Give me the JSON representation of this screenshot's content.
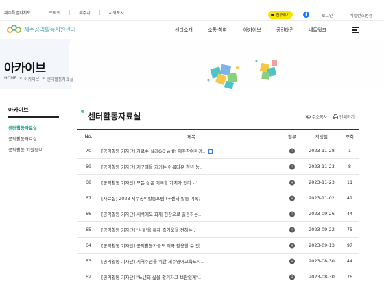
{
  "topbar": {
    "links": [
      "제주특별자치도",
      "도의회",
      "제주시",
      "서귀포시"
    ],
    "kakao_label": "친구추가",
    "facebook_glyph": "f",
    "login": "로그인",
    "password": "비밀번호변경"
  },
  "header": {
    "logo_text": "제주공익활동지원센터",
    "nav": [
      "센터소개",
      "소통·참여",
      "아카이브",
      "공간대관",
      "네트워크"
    ]
  },
  "hero": {
    "title": "아카이브",
    "breadcrumb": [
      "HOME",
      ">",
      "아카이브",
      ">",
      "센터활동자료실"
    ]
  },
  "sidebar": {
    "title": "아카이브",
    "items": [
      {
        "label": "센터활동자료실",
        "active": true
      },
      {
        "label": "공익활동자료실",
        "active": false
      },
      {
        "label": "공익활동 지원정보",
        "active": false
      }
    ]
  },
  "content": {
    "title": "센터활동자료실",
    "copy_address": "주소복사",
    "print": "인쇄하기",
    "columns": {
      "no": "No.",
      "title": "제목",
      "attach": "첨부",
      "date": "작성일",
      "views": "조회"
    },
    "rows": [
      {
        "no": "70",
        "title": "[공익활동 기자단] 가로수 살리GO with 제주참여환경..",
        "date": "2023-11-28",
        "views": "1",
        "new": true
      },
      {
        "no": "69",
        "title": "[공익활동 기자단] 지구별을 지키는 아름다운 청년 농..",
        "date": "2023-11-23",
        "views": "8",
        "new": false
      },
      {
        "no": "68",
        "title": "[공익활동 기자단] 모든 삶은 기록할 가치가 있다 - '..",
        "date": "2023-11-23",
        "views": "11",
        "new": false
      },
      {
        "no": "67",
        "title": "[자료집] 2023 제주공익활동포럼 (+센터 활동 기록)",
        "date": "2023-11-02",
        "views": "41",
        "new": false
      },
      {
        "no": "66",
        "title": "[공익활동 기자단] 새벽에도 화재 현장으로 출동하는..",
        "date": "2023-09-26",
        "views": "44",
        "new": false
      },
      {
        "no": "65",
        "title": "[공익활동 기자단] '식물'을 통해 즐거움을 전하는..",
        "date": "2023-09-22",
        "views": "75",
        "new": false
      },
      {
        "no": "64",
        "title": "[공익활동 기자단] 공익활동가들도 적극 활용할 수 있..",
        "date": "2023-09-13",
        "views": "97",
        "new": false
      },
      {
        "no": "63",
        "title": "[공익활동 기자단] 지역주민을 위한 제주영어교육도시..",
        "date": "2023-08-30",
        "views": "44",
        "new": false
      },
      {
        "no": "62",
        "title": "[공익활동 기자단] \"노년의 삶을 활기차고 보람있게\"..",
        "date": "2023-08-30",
        "views": "76",
        "new": false
      }
    ]
  },
  "colors": {
    "accent": "#1a9b8f",
    "kakao": "#f7e600",
    "facebook": "#1877f2",
    "hero_bg": "#f3f6fa"
  }
}
